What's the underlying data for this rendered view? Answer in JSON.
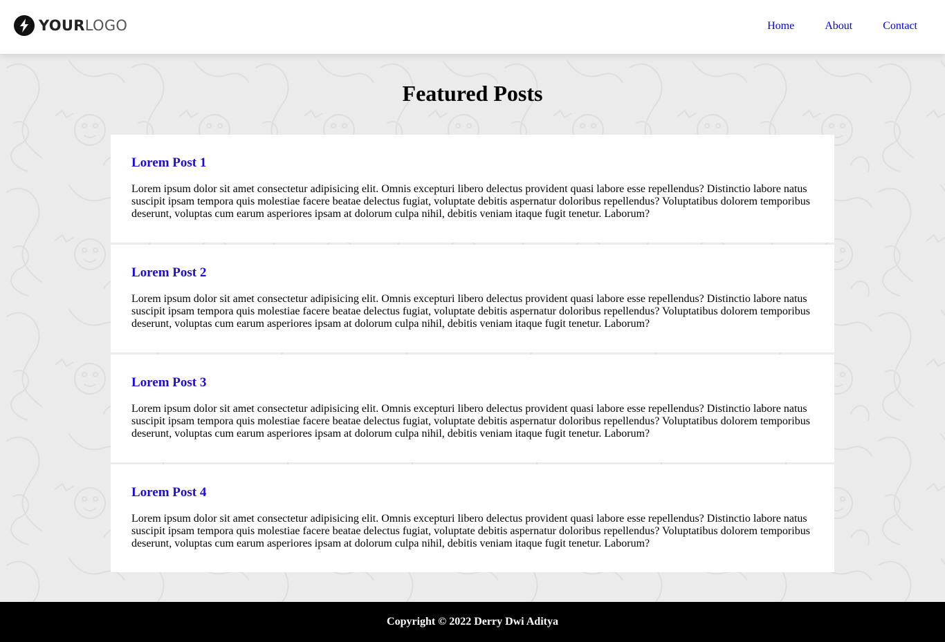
{
  "header": {
    "logo": {
      "strong": "YOUR",
      "light": "LOGO",
      "icon": "lightning-bolt-icon"
    },
    "nav": [
      {
        "label": "Home"
      },
      {
        "label": "About"
      },
      {
        "label": "Contact"
      }
    ]
  },
  "main": {
    "title": "Featured Posts",
    "posts": [
      {
        "title": "Lorem Post 1",
        "body": "Lorem ipsum dolor sit amet consectetur adipisicing elit. Omnis excepturi libero delectus provident quasi labore esse repellendus? Distinctio labore natus suscipit ipsam tempora quis molestiae facere beatae delectus fugiat, voluptate debitis aspernatur doloribus repellendus? Voluptatibus dolorem temporibus deserunt, voluptas cum earum asperiores ipsam at dolorum culpa nihil, debitis veniam itaque fugit tenetur. Laborum?"
      },
      {
        "title": "Lorem Post 2",
        "body": "Lorem ipsum dolor sit amet consectetur adipisicing elit. Omnis excepturi libero delectus provident quasi labore esse repellendus? Distinctio labore natus suscipit ipsam tempora quis molestiae facere beatae delectus fugiat, voluptate debitis aspernatur doloribus repellendus? Voluptatibus dolorem temporibus deserunt, voluptas cum earum asperiores ipsam at dolorum culpa nihil, debitis veniam itaque fugit tenetur. Laborum?"
      },
      {
        "title": "Lorem Post 3",
        "body": "Lorem ipsum dolor sit amet consectetur adipisicing elit. Omnis excepturi libero delectus provident quasi labore esse repellendus? Distinctio labore natus suscipit ipsam tempora quis molestiae facere beatae delectus fugiat, voluptate debitis aspernatur doloribus repellendus? Voluptatibus dolorem temporibus deserunt, voluptas cum earum asperiores ipsam at dolorum culpa nihil, debitis veniam itaque fugit tenetur. Laborum?"
      },
      {
        "title": "Lorem Post 4",
        "body": "Lorem ipsum dolor sit amet consectetur adipisicing elit. Omnis excepturi libero delectus provident quasi labore esse repellendus? Distinctio labore natus suscipit ipsam tempora quis molestiae facere beatae delectus fugiat, voluptate debitis aspernatur doloribus repellendus? Voluptatibus dolorem temporibus deserunt, voluptas cum earum asperiores ipsam at dolorum culpa nihil, debitis veniam itaque fugit tenetur. Laborum?"
      }
    ]
  },
  "footer": {
    "copyright": "Copyright © 2022 Derry Dwi Aditya"
  },
  "colors": {
    "link": "#0000ee",
    "post_title": "#1d0bde",
    "page_bg": "#ebebeb",
    "footer_bg": "#000000"
  }
}
